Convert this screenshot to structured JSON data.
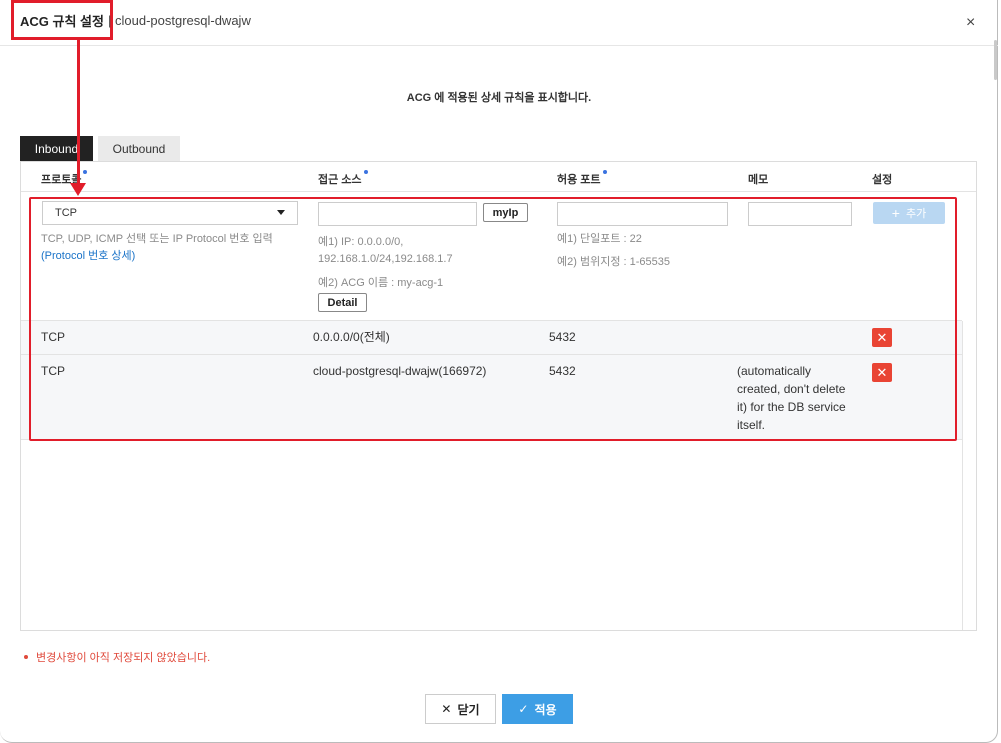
{
  "header": {
    "title": "ACG 규칙 설정",
    "subtitle": "| cloud-postgresql-dwajw",
    "close_glyph": "×"
  },
  "description": "ACG 에 적용된 상세 규칙을 표시합니다.",
  "tabs": [
    {
      "label": "Inbound",
      "active": true
    },
    {
      "label": "Outbound",
      "active": false
    }
  ],
  "columns": {
    "protocol": "프로토콜",
    "source": "접근 소스",
    "port": "허용 포트",
    "memo": "메모",
    "settings": "설정"
  },
  "form": {
    "protocol_value": "TCP",
    "protocol_hint_1": "TCP, UDP, ICMP 선택 또는 IP Protocol 번호 입력",
    "protocol_hint_link": "(Protocol 번호 상세)",
    "source_value": "",
    "myip_label": "myIp",
    "source_hint_1": "예1) IP: 0.0.0.0/0,",
    "source_hint_2": "192.168.1.0/24,192.168.1.7",
    "source_hint_3": "예2) ACG 이름 : my-acg-1",
    "detail_label": "Detail",
    "port_value": "",
    "port_hint_1": "예1) 단일포트 : 22",
    "port_hint_2": "예2) 범위지정 : 1-65535",
    "memo_value": "",
    "add_label": "추가",
    "add_icon": "+"
  },
  "rows": [
    {
      "protocol": "TCP",
      "source": "0.0.0.0/0(전체)",
      "port": "5432",
      "memo_lines": []
    },
    {
      "protocol": "TCP",
      "source": "cloud-postgresql-dwajw(166972)",
      "port": "5432",
      "memo_lines": [
        "(automatically",
        "created, don't delete",
        "it) for the DB service",
        "itself."
      ]
    }
  ],
  "delete_glyph": "✕",
  "warning": "변경사항이 아직 저장되지 않았습니다.",
  "footer": {
    "close_label": "닫기",
    "close_icon": "✕",
    "apply_label": "적용",
    "apply_icon": "✓"
  },
  "colors": {
    "annotation_red": "#e11d2a",
    "active_tab": "#222222",
    "primary": "#3d9ee5",
    "delete": "#e94434",
    "link": "#1a73c8"
  }
}
